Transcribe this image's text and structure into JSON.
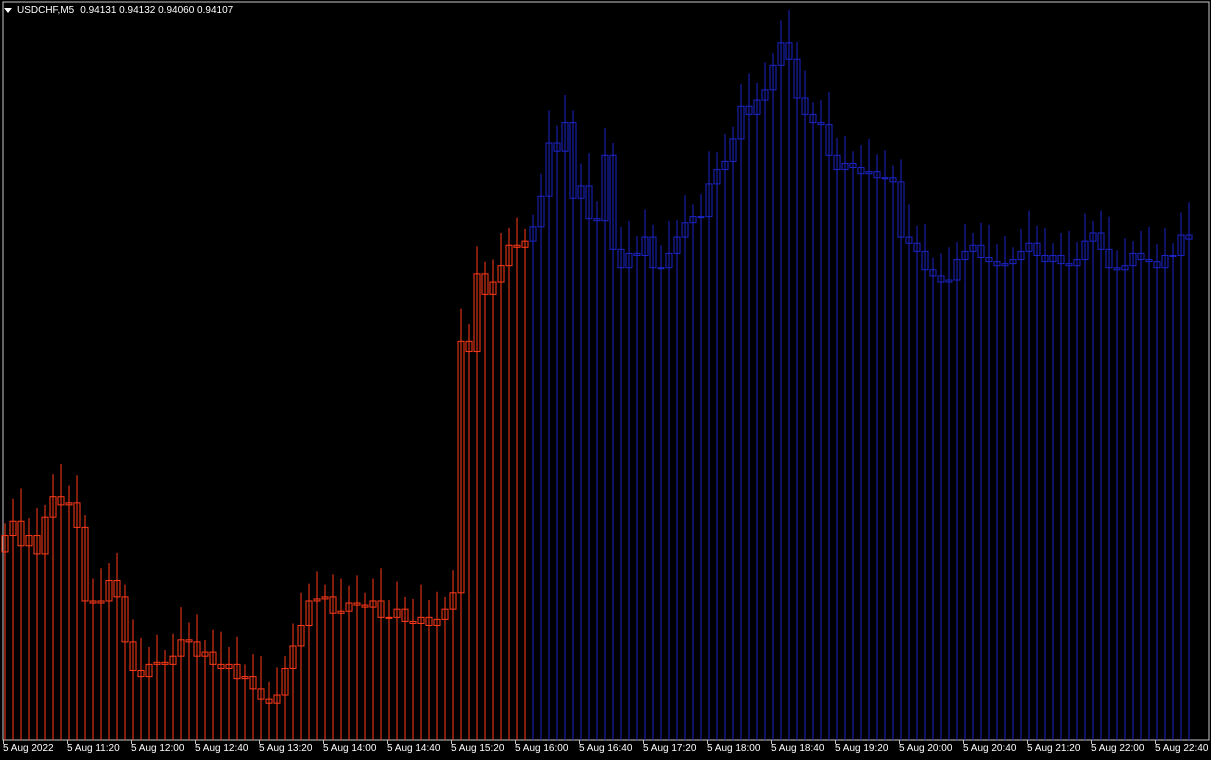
{
  "header": {
    "symbol": "USDCHF,M5",
    "open": "0.94131",
    "high": "0.94132",
    "low": "0.94060",
    "close": "0.94107"
  },
  "colors": {
    "background": "#000000",
    "frame": "#c8c8c8",
    "history_bars": "#ff3a1a",
    "forecast_bars": "#1c24c8",
    "text": "#ffffff"
  },
  "chart_data": {
    "type": "candlestick",
    "timeframe": "M5",
    "ylim": [
      0.9386,
      0.9422
    ],
    "time_labels": [
      "5 Aug 2022",
      "5 Aug 11:20",
      "5 Aug 12:00",
      "5 Aug 12:40",
      "5 Aug 13:20",
      "5 Aug 14:00",
      "5 Aug 14:40",
      "5 Aug 15:20",
      "5 Aug 16:00",
      "5 Aug 16:40",
      "5 Aug 17:20",
      "5 Aug 18:00",
      "5 Aug 18:40",
      "5 Aug 19:20",
      "5 Aug 20:00",
      "5 Aug 20:40",
      "5 Aug 21:20",
      "5 Aug 22:00",
      "5 Aug 22:40"
    ],
    "history_close": [
      0.9396,
      0.93967,
      0.93955,
      0.9396,
      0.93951,
      0.93969,
      0.93979,
      0.93975,
      0.93976,
      0.93964,
      0.93928,
      0.93927,
      0.93928,
      0.93938,
      0.9393,
      0.93908,
      0.93894,
      0.93891,
      0.93897,
      0.93898,
      0.93897,
      0.93901,
      0.93909,
      0.93908,
      0.93901,
      0.93903,
      0.93897,
      0.93895,
      0.93897,
      0.9389,
      0.93891,
      0.93885,
      0.9388,
      0.93878,
      0.93882,
      0.93895,
      0.93906,
      0.93916,
      0.93928,
      0.93929,
      0.9393,
      0.93922,
      0.93923,
      0.93927,
      0.93926,
      0.93925,
      0.93928,
      0.9392,
      0.9392,
      0.93924,
      0.93918,
      0.93917,
      0.9392,
      0.93916,
      0.93919,
      0.93924,
      0.93932,
      0.94055,
      0.9405,
      0.94088,
      0.94078,
      0.94084,
      0.94092,
      0.94102,
      0.94101,
      0.94104
    ],
    "forecast_close": [
      0.94111,
      0.94126,
      0.94152,
      0.94148,
      0.94162,
      0.94125,
      0.94131,
      0.94115,
      0.94114,
      0.94146,
      0.941,
      0.94091,
      0.94098,
      0.94097,
      0.94106,
      0.94091,
      0.94091,
      0.94098,
      0.94106,
      0.94113,
      0.94116,
      0.94116,
      0.94132,
      0.94139,
      0.94143,
      0.94154,
      0.9417,
      0.94166,
      0.94173,
      0.94178,
      0.9419,
      0.94201,
      0.94193,
      0.94174,
      0.94166,
      0.94162,
      0.94161,
      0.94146,
      0.94139,
      0.94142,
      0.9414,
      0.94137,
      0.94138,
      0.94135,
      0.94135,
      0.94133,
      0.94106,
      0.94103,
      0.94099,
      0.9409,
      0.94087,
      0.94084,
      0.94085,
      0.94095,
      0.94099,
      0.94102,
      0.94096,
      0.94094,
      0.94092,
      0.94093,
      0.94095,
      0.94099,
      0.94103,
      0.94097,
      0.94094,
      0.94097,
      0.94093,
      0.94092,
      0.94095,
      0.94104,
      0.94108,
      0.941,
      0.94091,
      0.9409,
      0.94092,
      0.94098,
      0.94095,
      0.94094,
      0.94091,
      0.94097,
      0.94097,
      0.94107,
      0.94105
    ]
  }
}
